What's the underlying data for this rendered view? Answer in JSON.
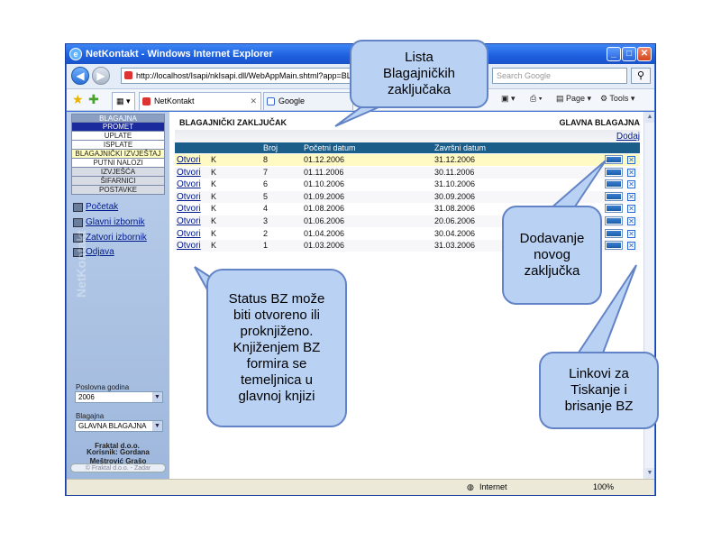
{
  "window": {
    "title": "NetKontakt - Windows Internet Explorer"
  },
  "navbar": {
    "address": "http://localhost/Isapi/nkIsapi.dll/WebAppMain.shtml?app=BLA",
    "search_placeholder": "Search Google"
  },
  "tabs": {
    "active": "NetKontakt",
    "second": "Google",
    "page_menu": "Page",
    "tools_menu": "Tools"
  },
  "sidebar": {
    "menu": [
      "BLAGAJNA",
      "PROMET",
      "UPLATE",
      "ISPLATE",
      "BLAGAJNIČKI IZVJEŠTAJ",
      "PUTNI NALOZI",
      "IZVJEŠĆA",
      "ŠIFARNICI",
      "POSTAVKE"
    ],
    "links": [
      "Početak",
      "Glavni izbornik",
      "Zatvori izbornik",
      "Odjava"
    ],
    "year_label": "Poslovna godina",
    "year_value": "2006",
    "cash_label": "Blagajna",
    "cash_value": "GLAVNA BLAGAJNA",
    "user_line1": "Korisnik: Gordana",
    "user_line2": "Meštrović Grašo",
    "company": "Fraktal d.o.o.",
    "footer": "© Fraktal d.o.o. - Zadar"
  },
  "main": {
    "title": "BLAGAJNIČKI ZAKLJUČAK",
    "register": "GLAVNA BLAGAJNA",
    "add_link": "Dodaj",
    "columns": {
      "broj": "Broj",
      "pocetni": "Početni datum",
      "zavrsni": "Završni datum"
    },
    "rows": [
      {
        "action": "Otvori",
        "status": "K",
        "broj": "8",
        "pocetni": "01.12.2006",
        "zavrsni": "31.12.2006"
      },
      {
        "action": "Otvori",
        "status": "K",
        "broj": "7",
        "pocetni": "01.11.2006",
        "zavrsni": "30.11.2006"
      },
      {
        "action": "Otvori",
        "status": "K",
        "broj": "6",
        "pocetni": "01.10.2006",
        "zavrsni": "31.10.2006"
      },
      {
        "action": "Otvori",
        "status": "K",
        "broj": "5",
        "pocetni": "01.09.2006",
        "zavrsni": "30.09.2006"
      },
      {
        "action": "Otvori",
        "status": "K",
        "broj": "4",
        "pocetni": "01.08.2006",
        "zavrsni": "31.08.2006"
      },
      {
        "action": "Otvori",
        "status": "K",
        "broj": "3",
        "pocetni": "01.06.2006",
        "zavrsni": "20.06.2006"
      },
      {
        "action": "Otvori",
        "status": "K",
        "broj": "2",
        "pocetni": "01.04.2006",
        "zavrsni": "30.04.2006"
      },
      {
        "action": "Otvori",
        "status": "K",
        "broj": "1",
        "pocetni": "01.03.2006",
        "zavrsni": "31.03.2006"
      }
    ]
  },
  "statusbar": {
    "zone": "Internet",
    "zoom": "100%"
  },
  "callouts": {
    "lista": [
      "Lista",
      "Blagajničkih",
      "zaključaka"
    ],
    "dodavanje": [
      "Dodavanje",
      "novog",
      "zaključka"
    ],
    "status": [
      "Status BZ može",
      "biti otvoreno ili",
      "proknjiženo.",
      "Knjiženjem BZ",
      "formira se",
      "temeljnica u",
      "glavnoj knjizi"
    ],
    "linkovi": [
      "Linkovi za",
      "Tiskanje  i",
      "brisanje BZ"
    ]
  },
  "colors": {
    "accent": "#1b5e8a",
    "selected_row": "#fffac4",
    "menu_selected": "#1b2a9c",
    "callout": "#b9d2f4"
  }
}
